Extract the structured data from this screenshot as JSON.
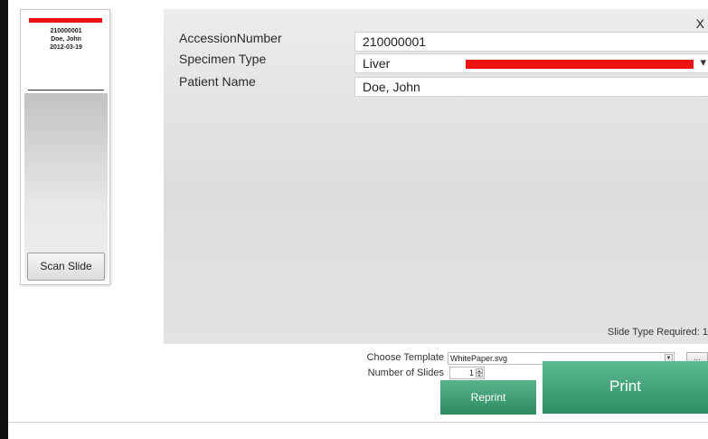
{
  "slide": {
    "accession": "210000001",
    "patient": "Doe, John",
    "date": "2012-03-19",
    "scan_label": "Scan Slide"
  },
  "form": {
    "close_label": "X",
    "accession_label": "AccessionNumber",
    "accession_value": "210000001",
    "specimen_label": "Specimen Type",
    "specimen_value": "Liver",
    "patient_label": "Patient Name",
    "patient_value": "Doe, John",
    "slide_type_required": "Slide Type Required: 1"
  },
  "template": {
    "choose_label": "Choose Template",
    "selected": "WhitePaper.svg",
    "browse_label": "...",
    "num_label": "Number of Slides",
    "num_value": "1"
  },
  "actions": {
    "reprint": "Reprint",
    "print": "Print"
  },
  "colors": {
    "accent_green": "#3a9a6f",
    "redaction_red": "#ee1111"
  }
}
